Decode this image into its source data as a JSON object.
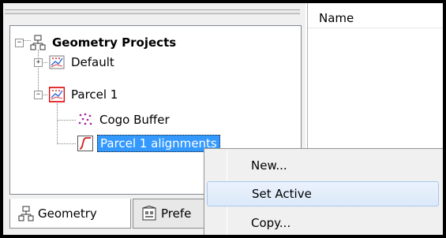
{
  "tree": {
    "root": {
      "label": "Geometry Projects",
      "expander": "−"
    },
    "items": [
      {
        "label": "Default",
        "expander": "+"
      },
      {
        "label": "Parcel 1",
        "expander": "−"
      },
      {
        "label": "Cogo Buffer"
      },
      {
        "label": "Parcel 1 alignments"
      }
    ]
  },
  "tabs": [
    {
      "label": "Geometry"
    },
    {
      "label": "Prefe"
    }
  ],
  "list": {
    "column_name": "Name"
  },
  "context_menu": {
    "items": [
      {
        "label": "New..."
      },
      {
        "label": "Set Active"
      },
      {
        "label": "Copy..."
      }
    ]
  },
  "colors": {
    "selection": "#3399ff",
    "hover": "#dce9f9",
    "alignment_icon": "#d62020"
  }
}
